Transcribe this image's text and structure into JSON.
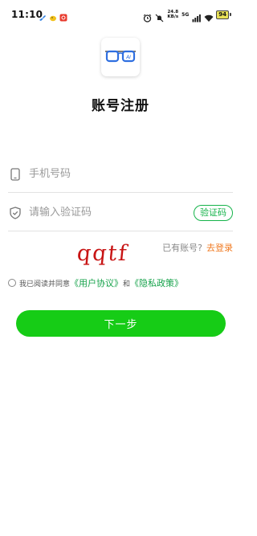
{
  "status_bar": {
    "time": "11:10",
    "net_speed_value": "24.8",
    "net_speed_unit": "KB/s",
    "signal_label": "5G",
    "battery": "94"
  },
  "app_logo": {
    "text": "AI"
  },
  "title": "账号注册",
  "phone_field": {
    "placeholder": "手机号码",
    "value": ""
  },
  "code_field": {
    "placeholder": "请输入验证码",
    "value": ""
  },
  "sms_button_label": "验证码",
  "captcha_text": "qqtf",
  "login_hint": {
    "text": "已有账号?",
    "link": "去登录"
  },
  "agreement": {
    "prefix": "我已阅读并同意",
    "user_agreement": "《用户协议》",
    "conjunction": "和",
    "privacy_policy": "《隐私政策》",
    "checked": false
  },
  "next_button_label": "下一步",
  "colors": {
    "primary_green": "#16cc16",
    "link_green": "#15a24a",
    "login_orange": "#f07a22",
    "captcha_red": "#c81414"
  }
}
